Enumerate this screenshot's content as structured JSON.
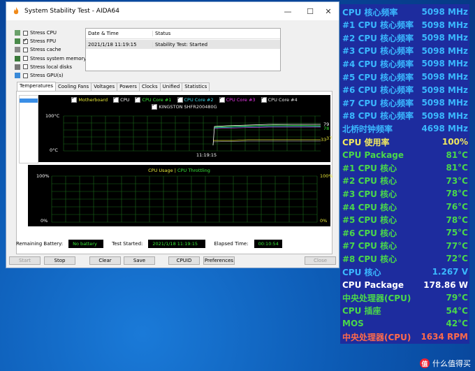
{
  "window": {
    "title": "System Stability Test - AIDA64",
    "minimize": "—",
    "maximize": "☐",
    "close": "✕"
  },
  "stress_options": [
    {
      "label": "Stress CPU",
      "checked": false,
      "icon": "cpu-icon"
    },
    {
      "label": "Stress FPU",
      "checked": true,
      "icon": "fpu-icon"
    },
    {
      "label": "Stress cache",
      "checked": false,
      "icon": "cache-icon"
    },
    {
      "label": "Stress system memory",
      "checked": false,
      "icon": "memory-icon"
    },
    {
      "label": "Stress local disks",
      "checked": false,
      "icon": "disk-icon"
    },
    {
      "label": "Stress GPU(s)",
      "checked": false,
      "icon": "gpu-icon"
    }
  ],
  "log": {
    "headers": [
      "Date & Time",
      "Status"
    ],
    "rows": [
      [
        "2021/1/18 11:19:15",
        "Stability Test: Started"
      ]
    ]
  },
  "tabs": [
    "Temperatures",
    "Cooling Fans",
    "Voltages",
    "Powers",
    "Clocks",
    "Unified",
    "Statistics"
  ],
  "temp_chart": {
    "legend": [
      {
        "label": "Motherboard",
        "color": "#e8e838"
      },
      {
        "label": "CPU",
        "color": "#ffffff"
      },
      {
        "label": "CPU Core #1",
        "color": "#38e838"
      },
      {
        "label": "CPU Core #2",
        "color": "#38d8e8"
      },
      {
        "label": "CPU Core #3",
        "color": "#e838e8"
      },
      {
        "label": "CPU Core #4",
        "color": "#e8e8e8"
      }
    ],
    "legend2": "KINGSTON SHFR200480G",
    "ymax_label": "100°C",
    "ymin_label": "0°C",
    "time_label": "11:19:15",
    "right_labels": [
      "79",
      "78",
      "33",
      "37"
    ]
  },
  "usage_chart": {
    "title_a": "CPU Usage",
    "sep": "|",
    "title_b": "CPU Throttling",
    "left_top": "100%",
    "left_bottom": "0%",
    "right_top": "100%",
    "right_bottom": "0%"
  },
  "status": {
    "battery_label": "Remaining Battery:",
    "battery_value": "No battery",
    "started_label": "Test Started:",
    "started_value": "2021/1/18 11:19:15",
    "elapsed_label": "Elapsed Time:",
    "elapsed_value": "00:10:54"
  },
  "buttons": {
    "start": "Start",
    "stop": "Stop",
    "clear": "Clear",
    "save": "Save",
    "cpuid": "CPUID",
    "preferences": "Preferences",
    "close": "Close"
  },
  "osd": [
    {
      "label": "CPU 核心频率",
      "value": "5098 MHz",
      "color": "#3ab8ff"
    },
    {
      "label": "#1 CPU 核心频率",
      "value": "5098 MHz",
      "color": "#3ab8ff"
    },
    {
      "label": "#2 CPU 核心频率",
      "value": "5098 MHz",
      "color": "#3ab8ff"
    },
    {
      "label": "#3 CPU 核心频率",
      "value": "5098 MHz",
      "color": "#3ab8ff"
    },
    {
      "label": "#4 CPU 核心频率",
      "value": "5098 MHz",
      "color": "#3ab8ff"
    },
    {
      "label": "#5 CPU 核心频率",
      "value": "5098 MHz",
      "color": "#3ab8ff"
    },
    {
      "label": "#6 CPU 核心频率",
      "value": "5098 MHz",
      "color": "#3ab8ff"
    },
    {
      "label": "#7 CPU 核心频率",
      "value": "5098 MHz",
      "color": "#3ab8ff"
    },
    {
      "label": "#8 CPU 核心频率",
      "value": "5098 MHz",
      "color": "#3ab8ff"
    },
    {
      "label": "北桥时钟频率",
      "value": "4698 MHz",
      "color": "#3ab8ff"
    },
    {
      "label": "CPU 使用率",
      "value": "100%",
      "color": "#f0e860"
    },
    {
      "label": "CPU Package",
      "value": "81°C",
      "color": "#4ad84a"
    },
    {
      "label": " #1 CPU 核心",
      "value": "81°C",
      "color": "#4ad84a"
    },
    {
      "label": " #2 CPU 核心",
      "value": "73°C",
      "color": "#4ad84a"
    },
    {
      "label": " #3 CPU 核心",
      "value": "78°C",
      "color": "#4ad84a"
    },
    {
      "label": " #4 CPU 核心",
      "value": "76°C",
      "color": "#4ad84a"
    },
    {
      "label": " #5 CPU 核心",
      "value": "78°C",
      "color": "#4ad84a"
    },
    {
      "label": " #6 CPU 核心",
      "value": "75°C",
      "color": "#4ad84a"
    },
    {
      "label": " #7 CPU 核心",
      "value": "77°C",
      "color": "#4ad84a"
    },
    {
      "label": " #8 CPU 核心",
      "value": "72°C",
      "color": "#4ad84a"
    },
    {
      "label": "CPU 核心",
      "value": "1.267 V",
      "color": "#3ab8ff"
    },
    {
      "label": "CPU Package",
      "value": "178.86 W",
      "color": "#ffffff"
    },
    {
      "label": "中央处理器(CPU)",
      "value": "79°C",
      "color": "#4ad84a"
    },
    {
      "label": "CPU 插座",
      "value": "54°C",
      "color": "#4ad84a"
    },
    {
      "label": "MOS",
      "value": "42°C",
      "color": "#4ad84a"
    },
    {
      "label": "中央处理器(CPU)",
      "value": "1634 RPM",
      "color": "#ff6a4a"
    }
  ],
  "watermark": {
    "icon": "值",
    "text": "什么值得买"
  }
}
